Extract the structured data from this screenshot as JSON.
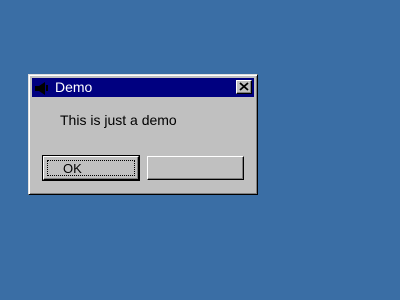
{
  "dialog": {
    "title": "Demo",
    "message": "This is just a demo",
    "buttons": {
      "ok_label": "OK",
      "second_label": ""
    }
  },
  "icons": {
    "app": "app-icon",
    "close": "close-icon"
  },
  "colors": {
    "desktop": "#3a6ea5",
    "titlebar": "#000080",
    "window_face": "#c0c0c0"
  }
}
